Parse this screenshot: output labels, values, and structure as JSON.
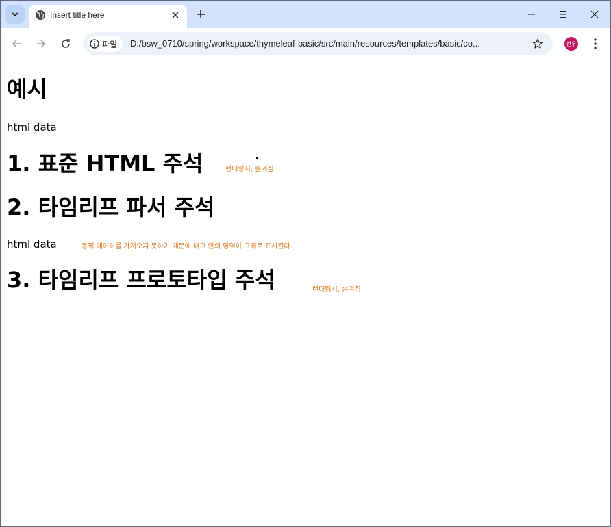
{
  "tab": {
    "title": "Insert title here"
  },
  "toolbar": {
    "site_chip_label": "파일",
    "url": "D:/bsw_0710/spring/workspace/thymeleaf-basic/src/main/resources/templates/basic/co...",
    "profile_initials": "선우"
  },
  "page": {
    "heading_example": "예시",
    "html_data_1": "html data",
    "heading_1": "1. 표준 HTML 주석",
    "note_1": "랜더링시, 숨겨짐",
    "heading_2": "2. 타임리프 파서 주석",
    "html_data_2": "html data",
    "note_2": "동적 데이터를 가져오지 못하기 때문에 태그 안의 영역이 그래로 표시된다.",
    "heading_3": "3. 타임리프 프로토타입 주석",
    "note_3": "랜더링시, 숨겨짐"
  },
  "colors": {
    "tabstrip": "#d3e3fd",
    "note": "#e07b22",
    "avatar": "#c2185b"
  }
}
